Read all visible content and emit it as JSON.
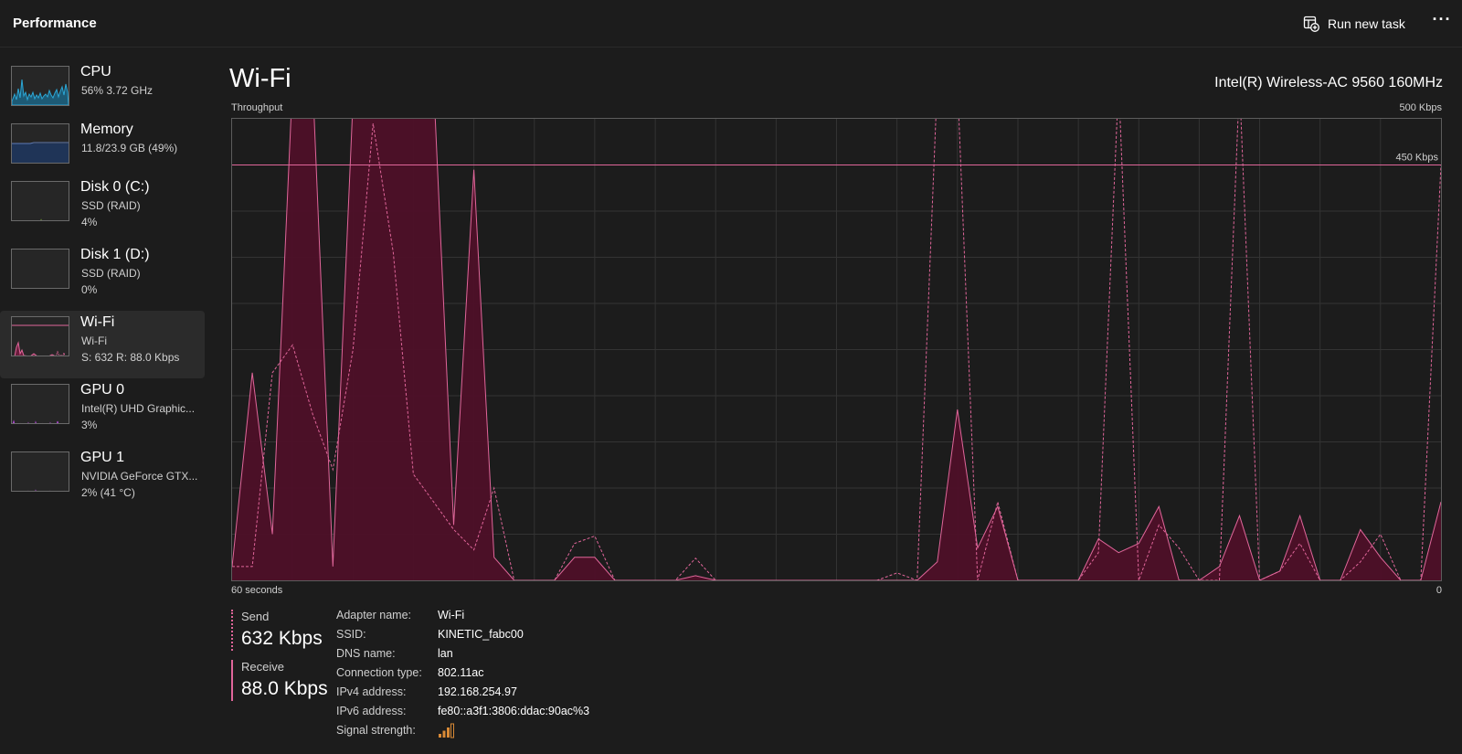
{
  "header": {
    "title": "Performance",
    "run_task_label": "Run new task",
    "more_label": "···"
  },
  "sidebar": {
    "items": [
      {
        "title": "CPU",
        "sub1": "56%  3.72 GHz",
        "sub2": "",
        "color": "#2ba7d6"
      },
      {
        "title": "Memory",
        "sub1": "11.8/23.9 GB (49%)",
        "sub2": "",
        "color": "#5f7bb7"
      },
      {
        "title": "Disk 0 (C:)",
        "sub1": "SSD (RAID)",
        "sub2": "4%",
        "color": "#8fc43a"
      },
      {
        "title": "Disk 1 (D:)",
        "sub1": "SSD (RAID)",
        "sub2": "0%",
        "color": "#8fc43a"
      },
      {
        "title": "Wi-Fi",
        "sub1": "Wi-Fi",
        "sub2": "S: 632  R: 88.0 Kbps",
        "color": "#e0669a"
      },
      {
        "title": "GPU 0",
        "sub1": "Intel(R) UHD Graphic...",
        "sub2": "3%",
        "color": "#b34ad8"
      },
      {
        "title": "GPU 1",
        "sub1": "NVIDIA GeForce GTX...",
        "sub2": "2%  (41 °C)",
        "color": "#b34ad8"
      }
    ],
    "selected_index": 4
  },
  "main": {
    "title": "Wi-Fi",
    "adapter_model": "Intel(R) Wireless-AC 9560 160MHz",
    "graph_label": "Throughput",
    "max_label": "500 Kbps",
    "line_label": "450 Kbps",
    "time_label": "60 seconds",
    "zero_label": "0"
  },
  "chart_data": {
    "type": "area",
    "title": "Throughput",
    "xlabel": "60 seconds",
    "ylabel": "",
    "ylim": [
      0,
      500
    ],
    "xlim": [
      60,
      0
    ],
    "grid": true,
    "reference_line": 450,
    "color": "#e0669a",
    "series": [
      {
        "name": "Receive",
        "style": "solid-filled",
        "x": [
          60,
          59,
          58,
          57,
          56,
          55,
          54,
          53,
          52,
          51,
          50,
          49,
          48,
          47,
          46,
          45,
          44,
          43,
          42,
          41,
          40,
          39,
          38,
          37,
          36,
          35,
          34,
          33,
          32,
          31,
          30,
          29,
          28,
          27,
          26,
          25,
          24,
          23,
          22,
          21,
          20,
          19,
          18,
          17,
          16,
          15,
          14,
          13,
          12,
          11,
          10,
          9,
          8,
          7,
          6,
          5,
          4,
          3,
          2,
          1,
          0
        ],
        "values": [
          15,
          225,
          50,
          540,
          540,
          15,
          520,
          540,
          540,
          540,
          540,
          60,
          445,
          25,
          0,
          0,
          0,
          25,
          25,
          0,
          0,
          0,
          0,
          5,
          0,
          0,
          0,
          0,
          0,
          0,
          0,
          0,
          0,
          0,
          0,
          20,
          185,
          35,
          80,
          0,
          0,
          0,
          0,
          45,
          30,
          40,
          80,
          0,
          0,
          15,
          70,
          0,
          10,
          70,
          0,
          0,
          55,
          25,
          0,
          0,
          85
        ]
      },
      {
        "name": "Send",
        "style": "dashed",
        "x": [
          60,
          59,
          58,
          57,
          56,
          55,
          54,
          53,
          52,
          51,
          50,
          49,
          48,
          47,
          46,
          45,
          44,
          43,
          42,
          41,
          40,
          39,
          38,
          37,
          36,
          35,
          34,
          33,
          32,
          31,
          30,
          29,
          28,
          27,
          26,
          25,
          24,
          23,
          22,
          21,
          20,
          19,
          18,
          17,
          16,
          15,
          14,
          13,
          12,
          11,
          10,
          9,
          8,
          7,
          6,
          5,
          4,
          3,
          2,
          1,
          0
        ],
        "values": [
          15,
          15,
          225,
          255,
          180,
          120,
          250,
          495,
          355,
          115,
          85,
          55,
          33,
          100,
          0,
          0,
          0,
          40,
          48,
          0,
          0,
          0,
          0,
          24,
          0,
          0,
          0,
          0,
          0,
          0,
          0,
          0,
          0,
          8,
          0,
          540,
          540,
          0,
          85,
          0,
          0,
          0,
          0,
          30,
          540,
          0,
          60,
          35,
          0,
          0,
          540,
          0,
          10,
          40,
          0,
          0,
          20,
          50,
          0,
          0,
          450
        ]
      }
    ]
  },
  "stats": {
    "send_label": "Send",
    "send_value": "632 Kbps",
    "recv_label": "Receive",
    "recv_value": "88.0 Kbps"
  },
  "properties": [
    {
      "label": "Adapter name:",
      "value": "Wi-Fi"
    },
    {
      "label": "SSID:",
      "value": "KINETIC_fabc00"
    },
    {
      "label": "DNS name:",
      "value": "lan"
    },
    {
      "label": "Connection type:",
      "value": "802.11ac"
    },
    {
      "label": "IPv4 address:",
      "value": "192.168.254.97"
    },
    {
      "label": "IPv6 address:",
      "value": "fe80::a3f1:3806:ddac:90ac%3"
    },
    {
      "label": "Signal strength:",
      "value": "",
      "icon": "signal-strength-icon",
      "bars": 3,
      "max_bars": 4
    }
  ],
  "icons": {
    "run_task": "run-task-icon",
    "more": "more-options-icon",
    "signal": "signal-strength-icon"
  }
}
